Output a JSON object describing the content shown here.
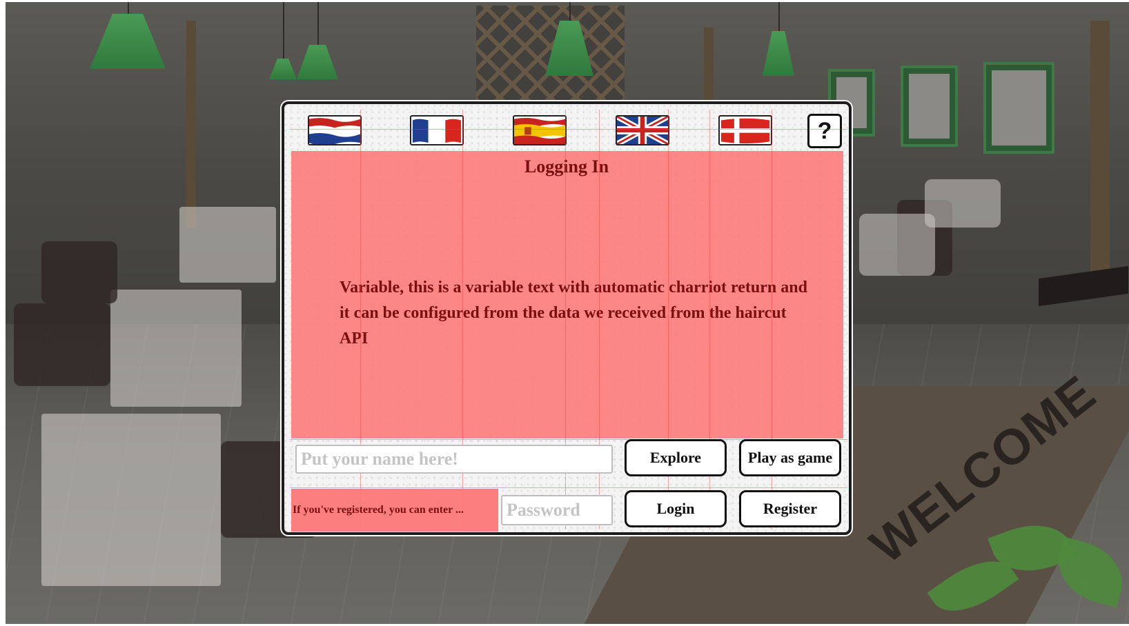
{
  "dialog": {
    "title": "Logging In",
    "message": "Variable, this is a variable text with automatic charriot return and it can be configured from the data we received from the haircut API",
    "help_label": "?"
  },
  "languages": [
    {
      "code": "nl",
      "icon": "dutch-flag-icon"
    },
    {
      "code": "fr",
      "icon": "french-flag-icon"
    },
    {
      "code": "es",
      "icon": "spanish-flag-icon"
    },
    {
      "code": "en",
      "icon": "uk-flag-icon"
    },
    {
      "code": "da",
      "icon": "danish-flag-icon"
    }
  ],
  "form": {
    "name_placeholder": "Put your name here!",
    "password_placeholder": "Password",
    "registered_hint": "If you've registered, you can enter ..."
  },
  "buttons": {
    "explore": "Explore",
    "play_as_game": "Play as game",
    "login": "Login",
    "register": "Register"
  },
  "background": {
    "rug_text": "WELCOME"
  },
  "colors": {
    "panel": "#fc7878",
    "text": "#7a0f0f",
    "lamp_green": "#3d8c48"
  }
}
